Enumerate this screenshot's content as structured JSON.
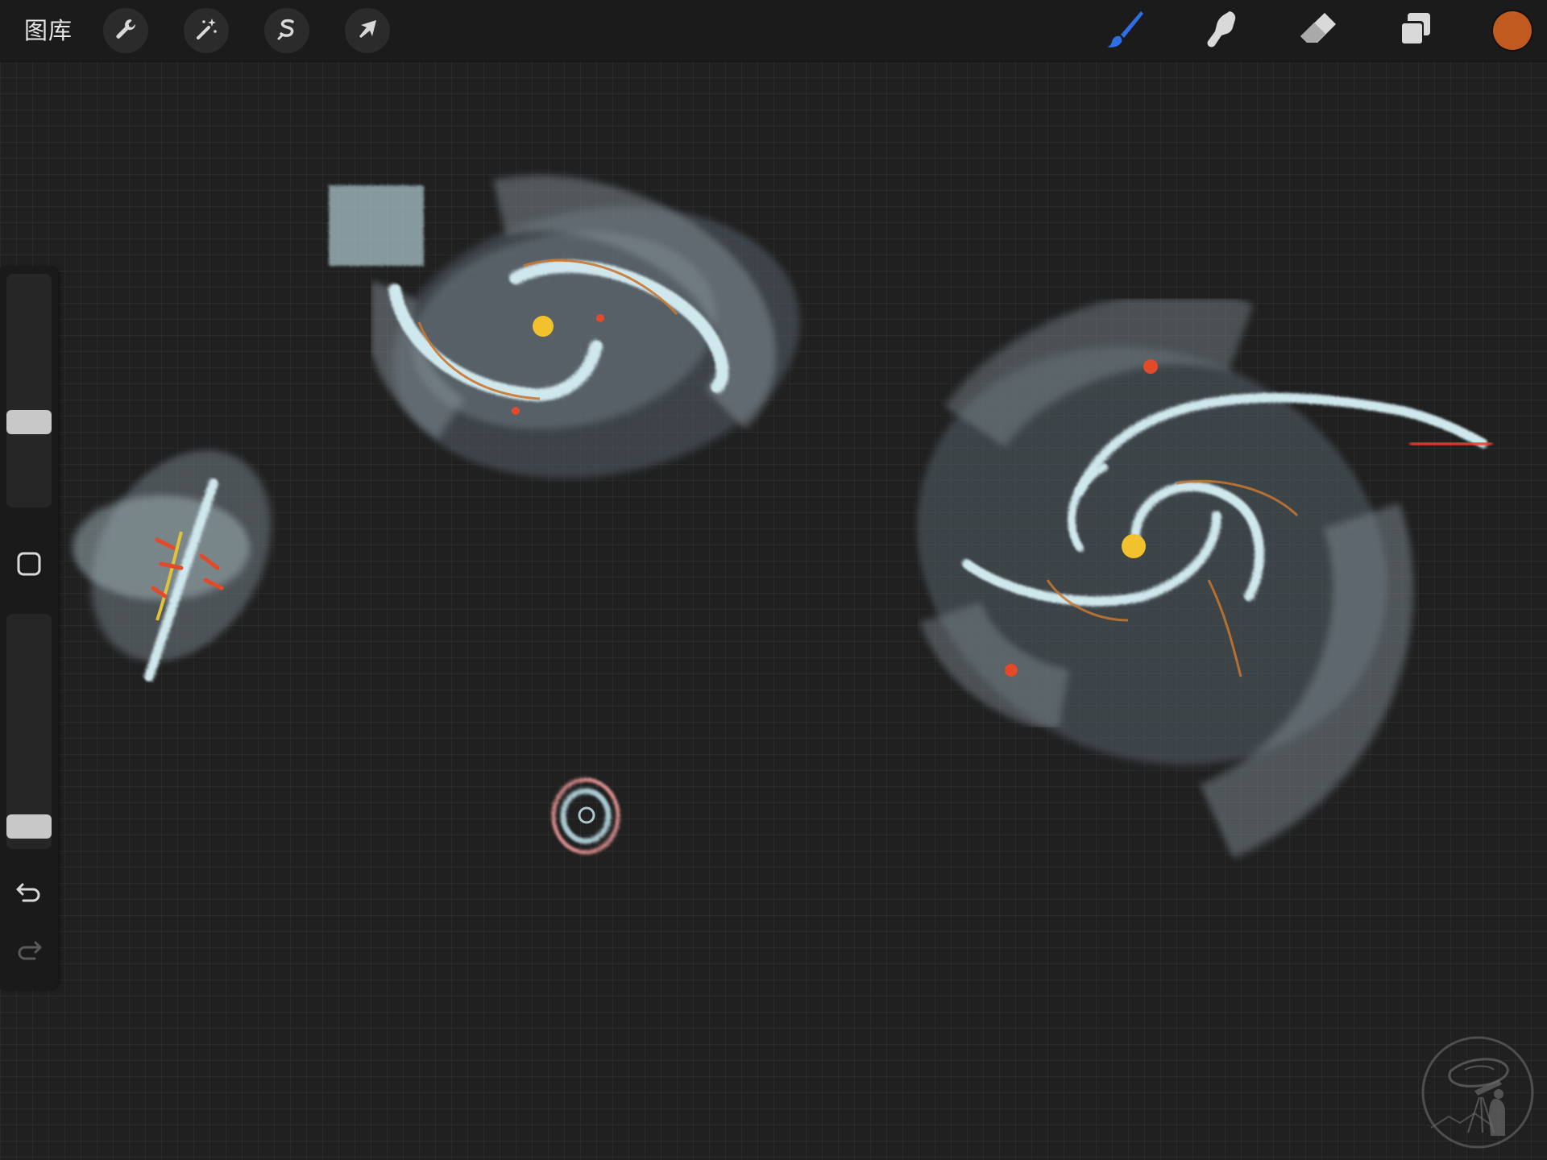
{
  "topbar": {
    "gallery_label": "图库",
    "left_tools": [
      {
        "name": "actions",
        "icon": "wrench-icon"
      },
      {
        "name": "adjustments",
        "icon": "magic-wand-icon"
      },
      {
        "name": "selection",
        "icon": "selection-s-icon"
      },
      {
        "name": "transform",
        "icon": "arrow-cursor-icon"
      }
    ],
    "right_tools": [
      {
        "name": "brush",
        "icon": "brush-icon",
        "active": true
      },
      {
        "name": "smudge",
        "icon": "smudge-finger-icon"
      },
      {
        "name": "eraser",
        "icon": "eraser-icon"
      },
      {
        "name": "layers",
        "icon": "layers-icon"
      }
    ],
    "current_color": "#c05a1f",
    "active_tool_color": "#2f6fe6"
  },
  "sidebar": {
    "brush_size_level": 0.35,
    "opacity_level": 0.05,
    "modify_icon": "square-modify-icon",
    "undo_icon": "undo-arrow-icon",
    "redo_icon": "redo-arrow-icon"
  },
  "canvas": {
    "background": "#202020",
    "watermark_icon": "astronomer-telescope-galaxy-icon"
  }
}
